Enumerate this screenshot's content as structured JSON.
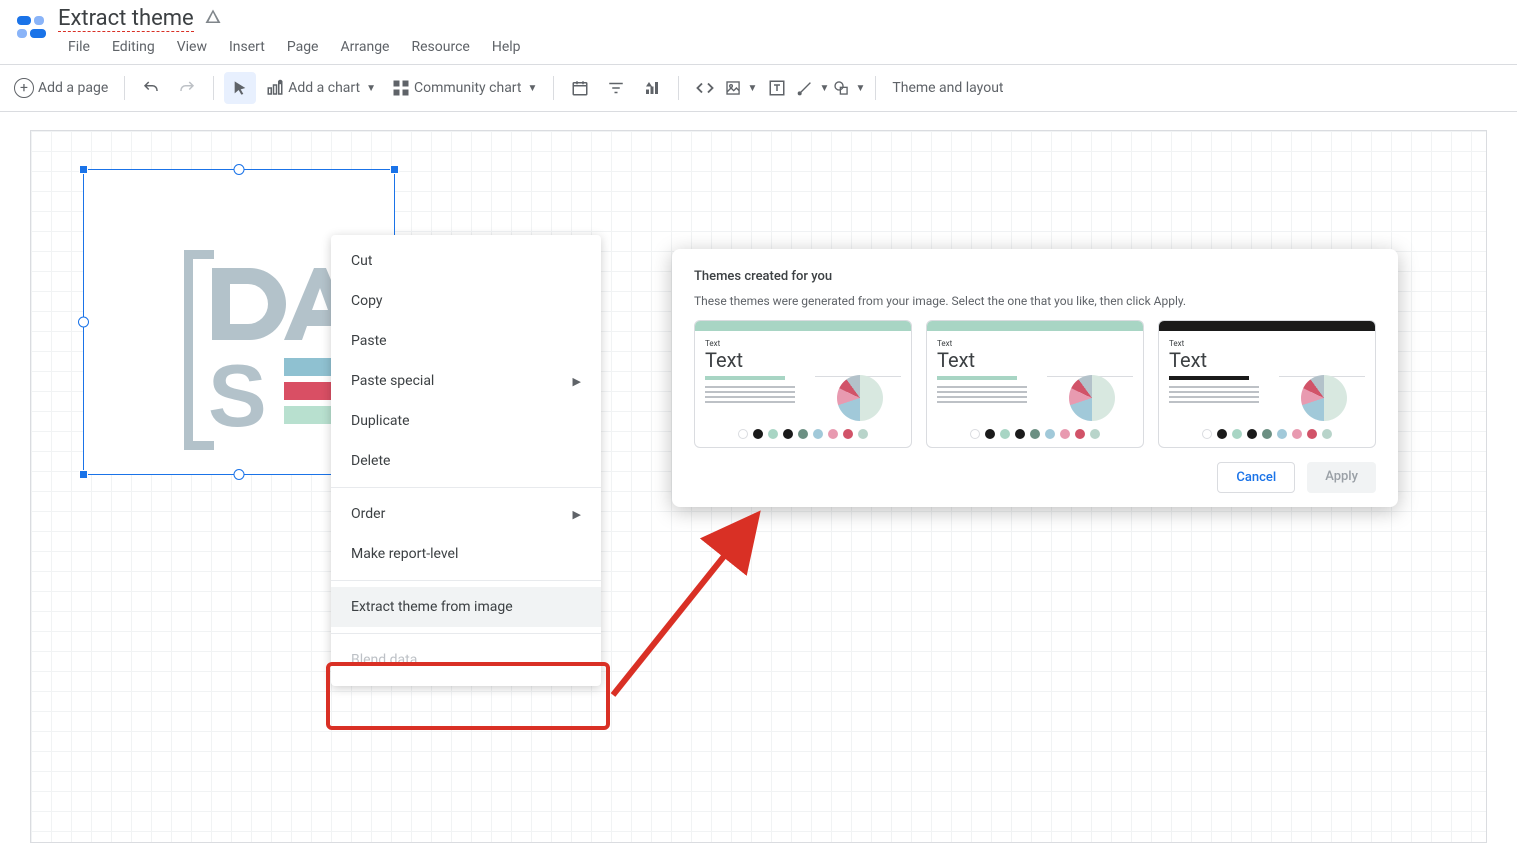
{
  "header": {
    "doc_title": "Extract theme",
    "menu": [
      "File",
      "Editing",
      "View",
      "Insert",
      "Page",
      "Arrange",
      "Resource",
      "Help"
    ]
  },
  "toolbar": {
    "add_page": "Add a page",
    "add_chart": "Add a chart",
    "community_chart": "Community chart",
    "theme_layout": "Theme and layout"
  },
  "context_menu": {
    "cut": "Cut",
    "copy": "Copy",
    "paste": "Paste",
    "paste_special": "Paste special",
    "duplicate": "Duplicate",
    "delete": "Delete",
    "order": "Order",
    "make_report_level": "Make report-level",
    "extract_theme": "Extract theme from image",
    "blend_data": "Blend data"
  },
  "theme_dialog": {
    "title": "Themes created for you",
    "description": "These themes were generated from your image. Select the one that you like, then click Apply.",
    "card_text_small": "Text",
    "card_text_big": "Text",
    "cancel": "Cancel",
    "apply": "Apply",
    "cards": [
      {
        "top": "#a8d5c4",
        "underline": "#a8d5c4"
      },
      {
        "top": "#a8d5c4",
        "underline": "#a8d5c4"
      },
      {
        "top": "#1a1a1a",
        "underline": "#1a1a1a"
      }
    ],
    "swatches": [
      "#ffffff",
      "#1a1a1a",
      "#a8d5c4",
      "#1a1a1a",
      "#6b8f82",
      "#a1c9d9",
      "#e89ab0",
      "#d15368",
      "#b8d4ca"
    ]
  }
}
